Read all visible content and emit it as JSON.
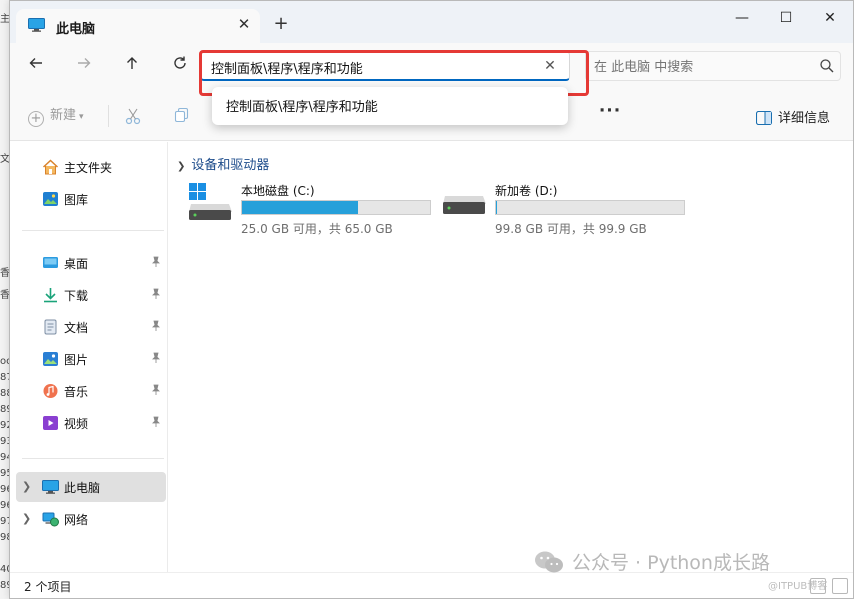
{
  "background_fragments": [
    "主组",
    "文",
    "香",
    "香",
    "oo",
    "87",
    "88",
    "89",
    "92",
    "93",
    "94",
    "95",
    "96",
    "96",
    "97",
    "98",
    "40",
    "89"
  ],
  "window": {
    "tab_title": "此电脑",
    "new_tab_symbol": "+",
    "close_symbol": "✕",
    "minimize_symbol": "—",
    "maximize_symbol": "☐"
  },
  "navbar": {
    "address_value": "控制面板\\程序\\程序和功能",
    "address_clear_symbol": "✕",
    "search_placeholder": "在 此电脑 中搜索"
  },
  "suggestion": {
    "items": [
      "控制面板\\程序\\程序和功能"
    ]
  },
  "toolbar": {
    "new_label": "新建",
    "more_symbol": "···",
    "details_label": "详细信息"
  },
  "sidebar": {
    "items": [
      {
        "label": "主文件夹"
      },
      {
        "label": "图库"
      },
      {
        "label": "桌面"
      },
      {
        "label": "下载"
      },
      {
        "label": "文档"
      },
      {
        "label": "图片"
      },
      {
        "label": "音乐"
      },
      {
        "label": "视频"
      },
      {
        "label": "此电脑"
      },
      {
        "label": "网络"
      }
    ]
  },
  "main": {
    "group_title": "设备和驱动器",
    "drives": [
      {
        "name": "本地磁盘 (C:)",
        "size_text": "25.0 GB 可用，共 65.0 GB",
        "used_fraction": 0.615
      },
      {
        "name": "新加卷 (D:)",
        "size_text": "99.8 GB 可用，共 99.9 GB",
        "used_fraction": 0.001
      }
    ]
  },
  "status": {
    "count": "2 个项目"
  },
  "watermark": {
    "text": "公众号 · Python成长路",
    "sub": "@ITPUB博客"
  },
  "colors": {
    "accent": "#0067c0",
    "drive_bar_fill": "#26a0da",
    "highlight_frame": "#e53935"
  }
}
